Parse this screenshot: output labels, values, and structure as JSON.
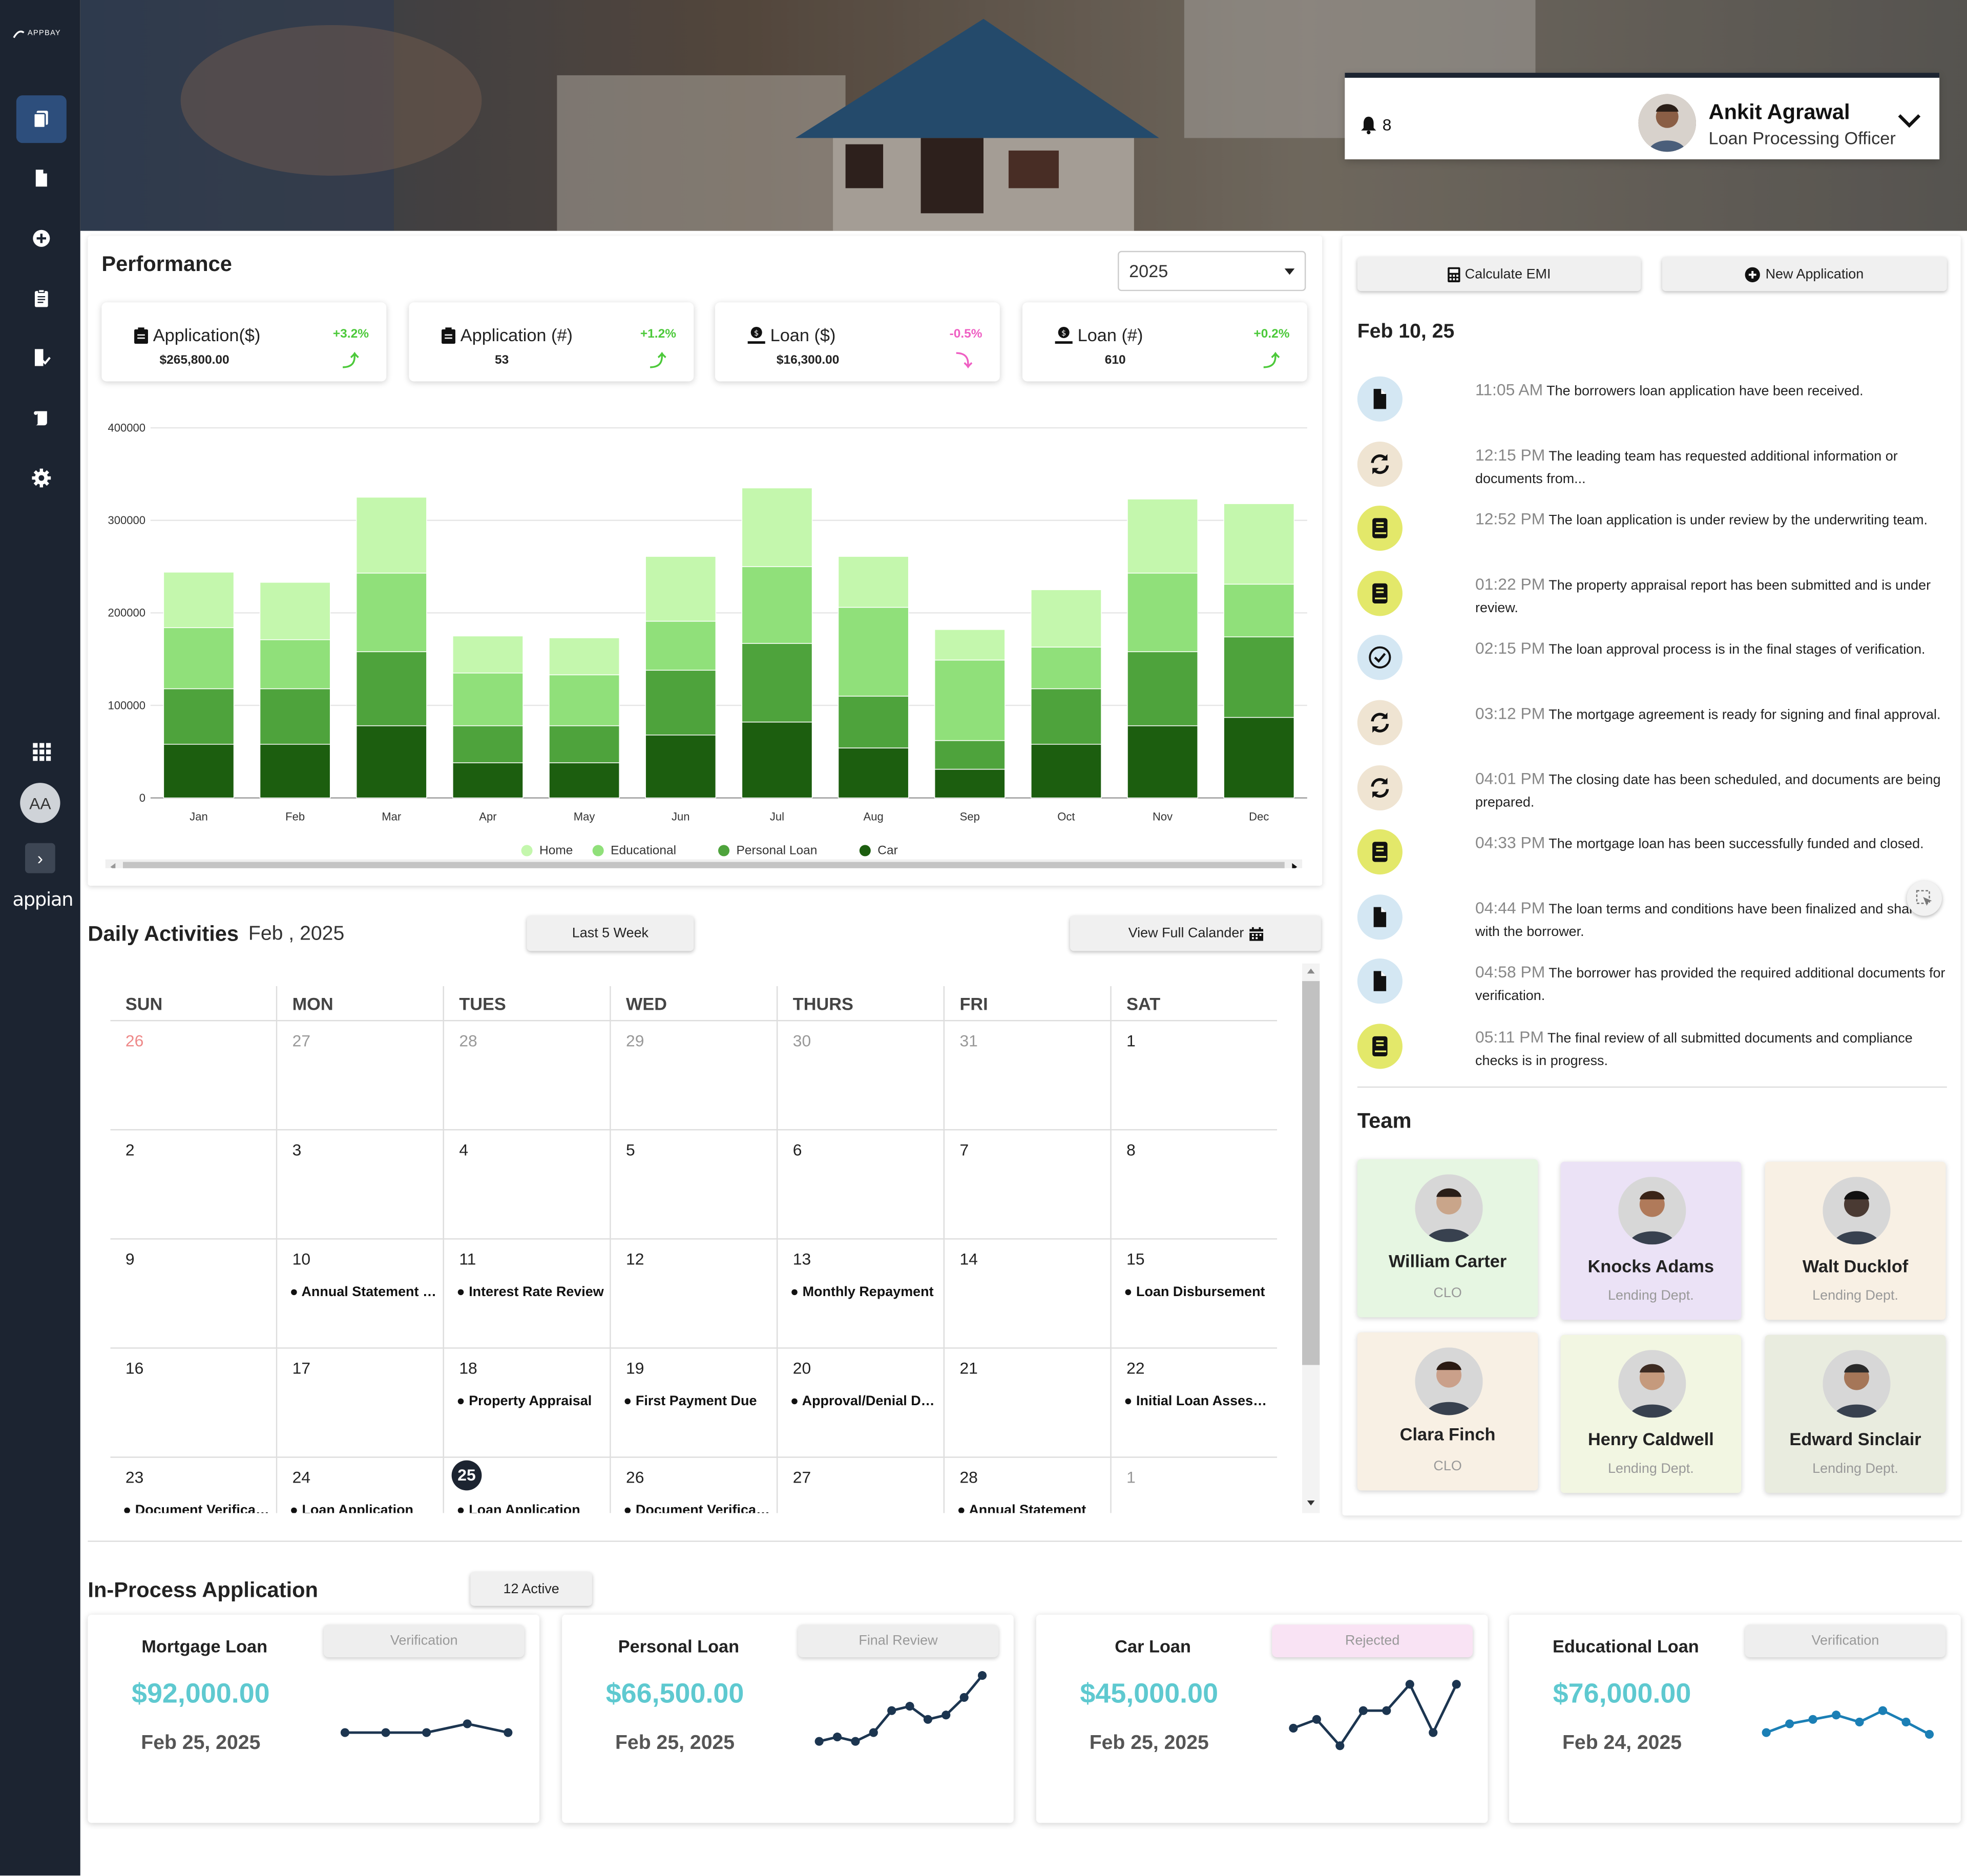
{
  "sidebar": {
    "logo_text": "APPBAY",
    "avatar_initials": "AA",
    "brand": "appian",
    "icons": [
      "documents-icon",
      "file-icon",
      "plus-circle-icon",
      "clipboard-icon",
      "building-check-icon",
      "scroll-icon",
      "gear-icon",
      "apps-grid-icon"
    ]
  },
  "header": {
    "notifications_count": "8",
    "user_name": "Ankit Agrawal",
    "user_role": "Loan Processing Officer"
  },
  "performance": {
    "title": "Performance",
    "year": "2025",
    "kpis": [
      {
        "label": "Application($)",
        "value": "$265,800.00",
        "change": "+3.2%",
        "direction": "up"
      },
      {
        "label": "Application (#)",
        "value": "53",
        "change": "+1.2%",
        "direction": "up"
      },
      {
        "label": "Loan ($)",
        "value": "$16,300.00",
        "change": "-0.5%",
        "direction": "down"
      },
      {
        "label": "Loan (#)",
        "value": "610",
        "change": "+0.2%",
        "direction": "up"
      }
    ]
  },
  "chart_data": {
    "type": "bar",
    "stacked": true,
    "categories": [
      "Jan",
      "Feb",
      "Mar",
      "Apr",
      "May",
      "Jun",
      "Jul",
      "Aug",
      "Sep",
      "Oct",
      "Nov",
      "Dec"
    ],
    "series": [
      {
        "name": "Car",
        "color": "#1c5e0f",
        "values": [
          58000,
          58000,
          78000,
          38000,
          38000,
          68000,
          82000,
          54000,
          31000,
          58000,
          78000,
          87000
        ]
      },
      {
        "name": "Personal Loan",
        "color": "#4ea33c",
        "values": [
          60000,
          60000,
          80000,
          40000,
          40000,
          70000,
          85000,
          56000,
          31000,
          60000,
          80000,
          87000
        ]
      },
      {
        "name": "Educational",
        "color": "#90e07a",
        "values": [
          66000,
          53000,
          85000,
          57000,
          55000,
          53000,
          83000,
          96000,
          87000,
          45000,
          85000,
          57000
        ]
      },
      {
        "name": "Home",
        "color": "#c4f7ad",
        "values": [
          60000,
          62000,
          82000,
          40000,
          40000,
          70000,
          85000,
          55000,
          33000,
          62000,
          80000,
          87000
        ]
      }
    ],
    "legend_order": [
      "Home",
      "Educational",
      "Personal Loan",
      "Car"
    ],
    "ylim": [
      0,
      400000
    ],
    "yticks": [
      "0",
      "100000",
      "200000",
      "300000",
      "400000"
    ],
    "grid": true,
    "legend_position": "bottom"
  },
  "daily": {
    "title": "Daily Activities",
    "month": "Feb , 2025",
    "range_button": "Last 5 Week",
    "view_button": "View Full Calander",
    "weekdays": [
      "SUN",
      "MON",
      "TUES",
      "WED",
      "THURS",
      "FRI",
      "SAT"
    ],
    "weeks": [
      [
        {
          "d": "26",
          "m": "red"
        },
        {
          "d": "27",
          "m": "muted"
        },
        {
          "d": "28",
          "m": "muted"
        },
        {
          "d": "29",
          "m": "muted"
        },
        {
          "d": "30",
          "m": "muted"
        },
        {
          "d": "31",
          "m": "muted"
        },
        {
          "d": "1"
        }
      ],
      [
        {
          "d": "2"
        },
        {
          "d": "3"
        },
        {
          "d": "4"
        },
        {
          "d": "5"
        },
        {
          "d": "6"
        },
        {
          "d": "7"
        },
        {
          "d": "8"
        }
      ],
      [
        {
          "d": "9"
        },
        {
          "d": "10",
          "e": "Annual Statement Review"
        },
        {
          "d": "11",
          "e": "Interest Rate Review"
        },
        {
          "d": "12"
        },
        {
          "d": "13",
          "e": "Monthly Repayment"
        },
        {
          "d": "14"
        },
        {
          "d": "15",
          "e": "Loan Disbursement"
        }
      ],
      [
        {
          "d": "16"
        },
        {
          "d": "17"
        },
        {
          "d": "18",
          "e": "Property Appraisal"
        },
        {
          "d": "19",
          "e": "First Payment Due"
        },
        {
          "d": "20",
          "e": "Approval/Denial Decision"
        },
        {
          "d": "21"
        },
        {
          "d": "22",
          "e": "Initial Loan Assessment"
        }
      ],
      [
        {
          "d": "23",
          "e": "Document Verification"
        },
        {
          "d": "24",
          "e": "Loan Application"
        },
        {
          "d": "25",
          "m": "today",
          "e": "Loan Application"
        },
        {
          "d": "26",
          "e": "Document Verification"
        },
        {
          "d": "27"
        },
        {
          "d": "28",
          "e": "Annual Statement"
        },
        {
          "d": "1",
          "m": "muted"
        }
      ]
    ]
  },
  "actions": {
    "calc": "Calculate EMI",
    "new_app": "New Application"
  },
  "timeline": {
    "date": "Feb 10, 25",
    "items": [
      {
        "time": "11:05 AM",
        "text": "The borrowers loan application have been received.",
        "icon": "file-icon",
        "bg": "#d4e7f3"
      },
      {
        "time": "12:15 PM",
        "text": "The leading team has requested additional information or documents from...",
        "icon": "refresh-icon",
        "bg": "#efe4d2"
      },
      {
        "time": "12:52 PM",
        "text": "The loan application is under review by the underwriting team.",
        "icon": "book-icon",
        "bg": "#e3e86a"
      },
      {
        "time": "01:22 PM",
        "text": "The property appraisal report has been submitted and is under review.",
        "icon": "book-icon",
        "bg": "#e3e86a"
      },
      {
        "time": "02:15 PM",
        "text": "The loan approval process is in the final stages of verification.",
        "icon": "check-circle-icon",
        "bg": "#d4e7f3"
      },
      {
        "time": "03:12 PM",
        "text": "The mortgage agreement is ready for signing and final approval.",
        "icon": "refresh-icon",
        "bg": "#efe4d2"
      },
      {
        "time": "04:01 PM",
        "text": "The closing date has been scheduled, and documents are being prepared.",
        "icon": "refresh-icon",
        "bg": "#efe4d2"
      },
      {
        "time": "04:33 PM",
        "text": "The mortgage loan has been successfully funded and closed.",
        "icon": "book-icon",
        "bg": "#e3e86a"
      },
      {
        "time": "04:44 PM",
        "text": "The loan terms and conditions have been finalized and shared with the borrower.",
        "icon": "file-icon",
        "bg": "#d4e7f3"
      },
      {
        "time": "04:58 PM",
        "text": "The borrower has provided the required additional documents for verification.",
        "icon": "file-icon",
        "bg": "#d4e7f3"
      },
      {
        "time": "05:11 PM",
        "text": "The final review of all submitted documents and compliance checks is in progress.",
        "icon": "book-icon",
        "bg": "#e3e86a"
      }
    ]
  },
  "team": {
    "title": "Team",
    "members": [
      {
        "name": "William Carter",
        "role": "CLO",
        "bg": "#e6f6e2"
      },
      {
        "name": "Knocks Adams",
        "role": "Lending Dept.",
        "bg": "#ebe2f6"
      },
      {
        "name": "Walt Ducklof",
        "role": "Lending Dept.",
        "bg": "#f8f0e4"
      },
      {
        "name": "Clara Finch",
        "role": "CLO",
        "bg": "#f8f0e4"
      },
      {
        "name": "Henry Caldwell",
        "role": "Lending Dept.",
        "bg": "#f2f6e2"
      },
      {
        "name": "Edward Sinclair",
        "role": "Lending Dept.",
        "bg": "#e9ecdf"
      }
    ]
  },
  "in_process": {
    "title": "In-Process Application",
    "badge": "12 Active",
    "apps": [
      {
        "title": "Mortgage Loan",
        "status": "Verification",
        "status_bg": "#eeeeee",
        "amount": "$92,000.00",
        "date": "Feb 25, 2025",
        "spark_color": "#1c3550",
        "trend": [
          0.3,
          0.3,
          0.3,
          0.4,
          0.3
        ]
      },
      {
        "title": "Personal Loan",
        "status": "Final Review",
        "status_bg": "#eeeeee",
        "amount": "$66,500.00",
        "date": "Feb 25, 2025",
        "spark_color": "#1c3550",
        "trend": [
          0.2,
          0.25,
          0.2,
          0.3,
          0.55,
          0.6,
          0.45,
          0.5,
          0.7,
          0.95
        ]
      },
      {
        "title": "Car Loan",
        "status": "Rejected",
        "status_bg": "#f9e3f4",
        "amount": "$45,000.00",
        "date": "Feb 25, 2025",
        "spark_color": "#1c3550",
        "trend": [
          0.35,
          0.45,
          0.15,
          0.55,
          0.55,
          0.85,
          0.3,
          0.85
        ]
      },
      {
        "title": "Educational Loan",
        "status": "Verification",
        "status_bg": "#eeeeee",
        "amount": "$76,000.00",
        "date": "Feb 24, 2025",
        "spark_color": "#1b7fb5",
        "trend": [
          0.3,
          0.4,
          0.45,
          0.5,
          0.42,
          0.55,
          0.42,
          0.28
        ]
      }
    ]
  }
}
